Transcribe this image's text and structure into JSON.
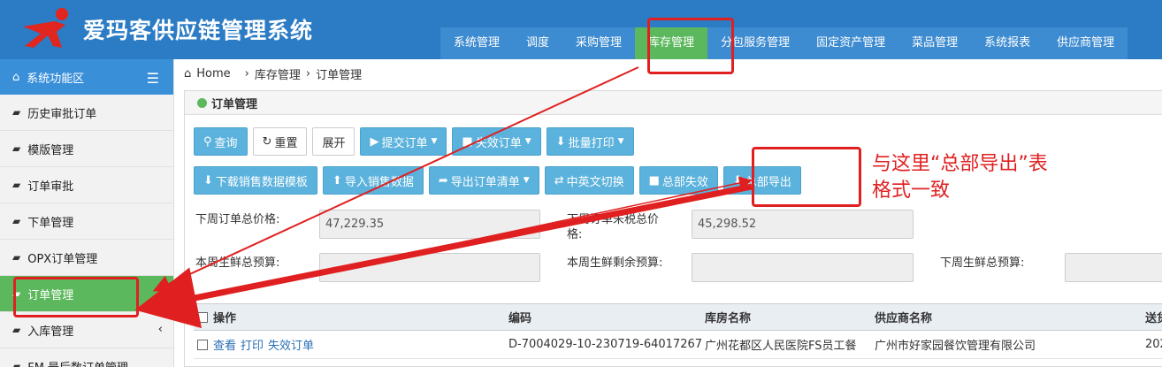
{
  "app": {
    "title": "爱玛客供应链管理系统"
  },
  "nav": [
    {
      "label": "系统管理"
    },
    {
      "label": "调度"
    },
    {
      "label": "采购管理"
    },
    {
      "label": "库存管理",
      "active": true
    },
    {
      "label": "分包服务管理"
    },
    {
      "label": "固定资产管理"
    },
    {
      "label": "菜品管理"
    },
    {
      "label": "系统报表"
    },
    {
      "label": "供应商管理"
    }
  ],
  "sidebar": {
    "header": "系统功能区",
    "items": [
      {
        "label": "历史审批订单"
      },
      {
        "label": "模版管理"
      },
      {
        "label": "订单审批"
      },
      {
        "label": "下单管理"
      },
      {
        "label": "OPX订单管理"
      },
      {
        "label": "订单管理",
        "active": true
      },
      {
        "label": "入库管理"
      },
      {
        "label": "FM 最后数订单管理"
      }
    ]
  },
  "breadcrumb": {
    "home": "Home",
    "sep": "›",
    "level1": "库存管理",
    "level2": "订单管理"
  },
  "panel": {
    "title": "订单管理"
  },
  "buttons_row1": [
    {
      "label": "查询",
      "icon": "search-icon"
    },
    {
      "label": "重置",
      "icon": "refresh-icon"
    },
    {
      "label": "展开"
    },
    {
      "label": "提交订单",
      "icon": "play-icon",
      "caret": "▼"
    },
    {
      "label": "失效订单",
      "icon": "square-icon",
      "caret": "▼"
    },
    {
      "label": "批量打印",
      "icon": "download-icon",
      "caret": "▼"
    }
  ],
  "buttons_row2": [
    {
      "label": "下载销售数据模板",
      "icon": "download-icon"
    },
    {
      "label": "导入销售数据",
      "icon": "upload-icon"
    },
    {
      "label": "导出订单清单",
      "icon": "share-icon",
      "caret": "▼"
    },
    {
      "label": "中英文切换",
      "icon": "swap-icon"
    },
    {
      "label": "总部失效",
      "icon": "square-icon"
    },
    {
      "label": "总部导出",
      "icon": "download-icon"
    }
  ],
  "fields": {
    "next_week_total_label": "下周订单总价格:",
    "next_week_total_value": "47,229.35",
    "next_week_unit_label": "下周订单未税总价格:",
    "next_week_unit_value": "45,298.52",
    "this_week_budget_label": "本周生鲜总预算:",
    "this_week_remaining_label": "本周生鲜剩余预算:",
    "next_week_budget_label": "下周生鲜总预算:"
  },
  "table": {
    "columns": [
      "操作",
      "编码",
      "库房名称",
      "供应商名称",
      "送货"
    ],
    "rows": [
      {
        "actions": [
          "查看",
          "打印",
          "失效订单"
        ],
        "code": "D-7004029-10-230719-64017267",
        "warehouse": "广州花都区人民医院FS员工餐",
        "supplier": "广州市好家园餐饮管理有限公司",
        "delivery": "202"
      }
    ]
  },
  "annotation": {
    "note": "与这里“总部导出”表格式一致"
  },
  "colors": {
    "header_bg": "#2b7cc4",
    "active_green": "#5cb85c",
    "button_blue": "#5bb2dc",
    "annotation_red": "#e02020"
  }
}
